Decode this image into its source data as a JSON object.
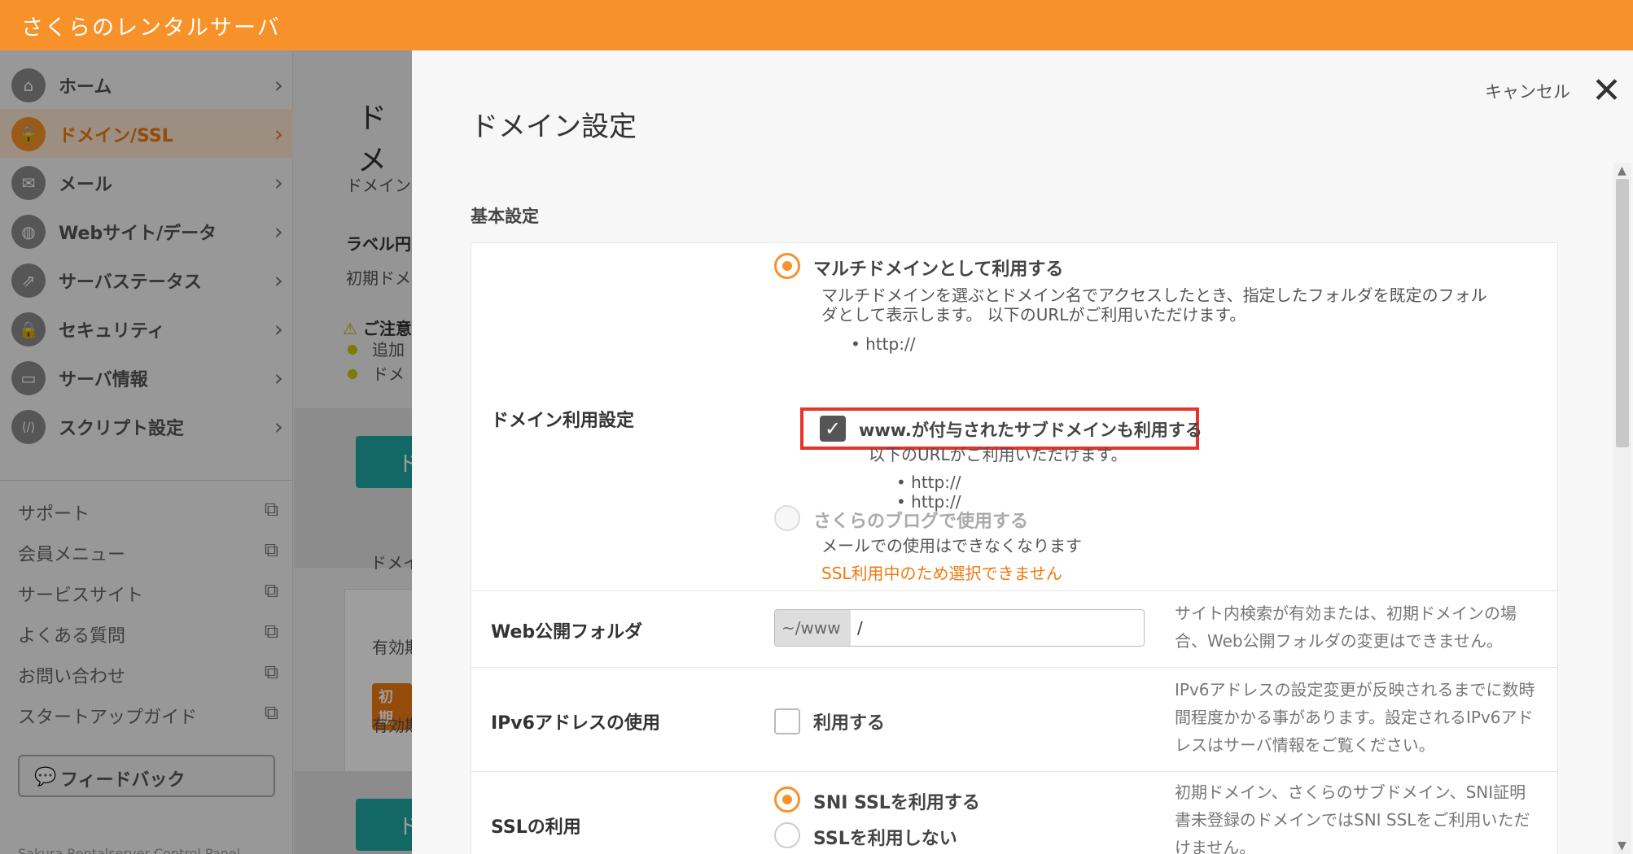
{
  "header": {
    "brand": "さくらのレンタルサーバ"
  },
  "sidebar": {
    "nav": [
      {
        "label": "ホーム",
        "icon": "home-icon",
        "glyph": "⌂"
      },
      {
        "label": "ドメイン/SSL",
        "icon": "domain-ssl-icon",
        "glyph": "🔒",
        "active": true
      },
      {
        "label": "メール",
        "icon": "mail-icon",
        "glyph": "✉"
      },
      {
        "label": "Webサイト/データ",
        "icon": "globe-icon",
        "glyph": "◍"
      },
      {
        "label": "サーバステータス",
        "icon": "chart-icon",
        "glyph": "⇗"
      },
      {
        "label": "セキュリティ",
        "icon": "lock-icon",
        "glyph": "🔒"
      },
      {
        "label": "サーバ情報",
        "icon": "server-icon",
        "glyph": "▭"
      },
      {
        "label": "スクリプト設定",
        "icon": "script-icon",
        "glyph": "⟨/⟩"
      }
    ],
    "links": [
      {
        "label": "サポート"
      },
      {
        "label": "会員メニュー"
      },
      {
        "label": "サービスサイト"
      },
      {
        "label": "よくある質問"
      },
      {
        "label": "お問い合わせ"
      },
      {
        "label": "スタートアップガイド"
      }
    ],
    "feedback_label": "フィードバック",
    "footnote": "Sakura Rentalserver Control Panel"
  },
  "background_page": {
    "title": "ドメ",
    "line1": "ドメイン",
    "label_row": "ラベル円",
    "initial": "初期ドメ",
    "warning": "ご注意",
    "bullet1": "追加",
    "bullet2": "ドメ",
    "button1": "ド",
    "card_text": "ドメイ",
    "valid1": "有効期",
    "badge": "初期",
    "valid2": "有効期",
    "button2": "ド"
  },
  "panel": {
    "title": "ドメイン設定",
    "cancel_label": "キャンセル",
    "section_heading": "基本設定",
    "domain_usage": {
      "label": "ドメイン利用設定",
      "multi_option": "マルチドメインとして利用する",
      "multi_desc_1": "マルチドメインを選ぶとドメイン名でアクセスしたとき、指定したフォルダを既定のフォル",
      "multi_desc_2": "ダとして表示します。 以下のURLがご利用いただけます。",
      "multi_url": "http://",
      "www_checkbox": "www.が付与されたサブドメインも利用する",
      "www_desc": "以下のURLがご利用いただけます。",
      "www_url_1": "http://",
      "www_url_2": "http://",
      "blog_option": "さくらのブログで使用する",
      "blog_desc": "メールでの使用はできなくなります",
      "blog_warning": "SSL利用中のため選択できません"
    },
    "web_folder": {
      "label": "Web公開フォルダ",
      "prefix": "~/www",
      "value": "/",
      "note": "サイト内検索が有効または、初期ドメインの場合、Web公開フォルダの変更はできません。"
    },
    "ipv6": {
      "label": "IPv6アドレスの使用",
      "checkbox": "利用する",
      "note": "IPv6アドレスの設定変更が反映されるまでに数時間程度かかる事があります。設定されるIPv6アドレスはサーバ情報をご覧ください。"
    },
    "ssl": {
      "label": "SSLの利用",
      "option_sni": "SNI SSLを利用する",
      "option_none": "SSLを利用しない",
      "note": "初期ドメイン、さくらのサブドメイン、SNI証明書未登録のドメインではSNI SSLをご利用いただけません。"
    }
  },
  "colors": {
    "brand_orange": "#f7922a",
    "teal": "#20a9a3",
    "highlight_red": "#e8332a"
  }
}
